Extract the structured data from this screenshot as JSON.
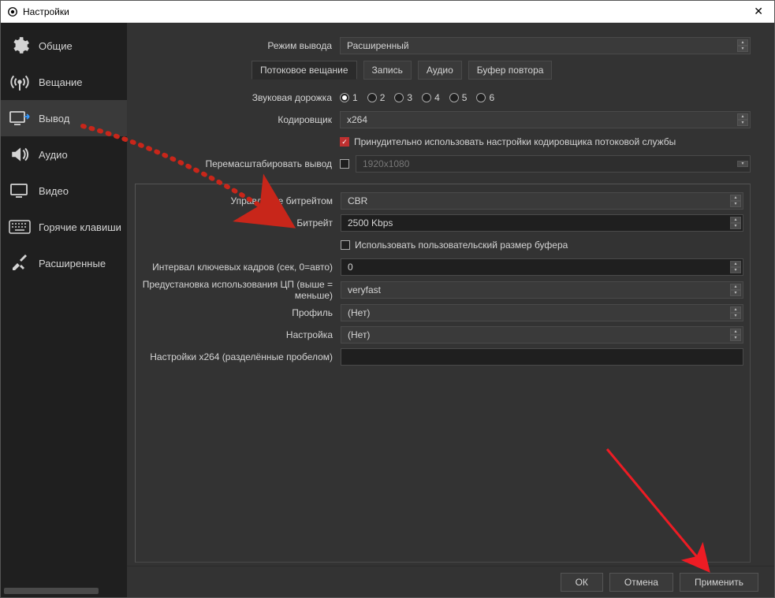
{
  "window": {
    "title": "Настройки"
  },
  "sidebar": {
    "items": [
      {
        "label": "Общие"
      },
      {
        "label": "Вещание"
      },
      {
        "label": "Вывод"
      },
      {
        "label": "Аудио"
      },
      {
        "label": "Видео"
      },
      {
        "label": "Горячие клавиши"
      },
      {
        "label": "Расширенные"
      }
    ],
    "active_index": 2
  },
  "output_mode": {
    "label": "Режим вывода",
    "value": "Расширенный"
  },
  "tabs": {
    "items": [
      {
        "label": "Потоковое вещание"
      },
      {
        "label": "Запись"
      },
      {
        "label": "Аудио"
      },
      {
        "label": "Буфер повтора"
      }
    ],
    "active_index": 0
  },
  "stream": {
    "audio_track_label": "Звуковая дорожка",
    "audio_tracks": [
      "1",
      "2",
      "3",
      "4",
      "5",
      "6"
    ],
    "audio_track_selected": 0,
    "encoder_label": "Кодировщик",
    "encoder_value": "x264",
    "enforce_label": "Принудительно использовать настройки кодировщика потоковой службы",
    "enforce_checked": true,
    "rescale_label": "Перемасштабировать вывод",
    "rescale_checked": false,
    "rescale_value": "1920x1080"
  },
  "encoder": {
    "rate_control_label": "Управление битрейтом",
    "rate_control_value": "CBR",
    "bitrate_label": "Битрейт",
    "bitrate_value": "2500 Kbps",
    "custom_buffer_label": "Использовать пользовательский размер буфера",
    "custom_buffer_checked": false,
    "keyint_label": "Интервал ключевых кадров (сек, 0=авто)",
    "keyint_value": "0",
    "preset_label": "Предустановка использования ЦП (выше = меньше)",
    "preset_value": "veryfast",
    "profile_label": "Профиль",
    "profile_value": "(Нет)",
    "tune_label": "Настройка",
    "tune_value": "(Нет)",
    "x264opts_label": "Настройки x264 (разделённые пробелом)",
    "x264opts_value": ""
  },
  "footer": {
    "ok": "ОК",
    "cancel": "Отмена",
    "apply": "Применить"
  }
}
